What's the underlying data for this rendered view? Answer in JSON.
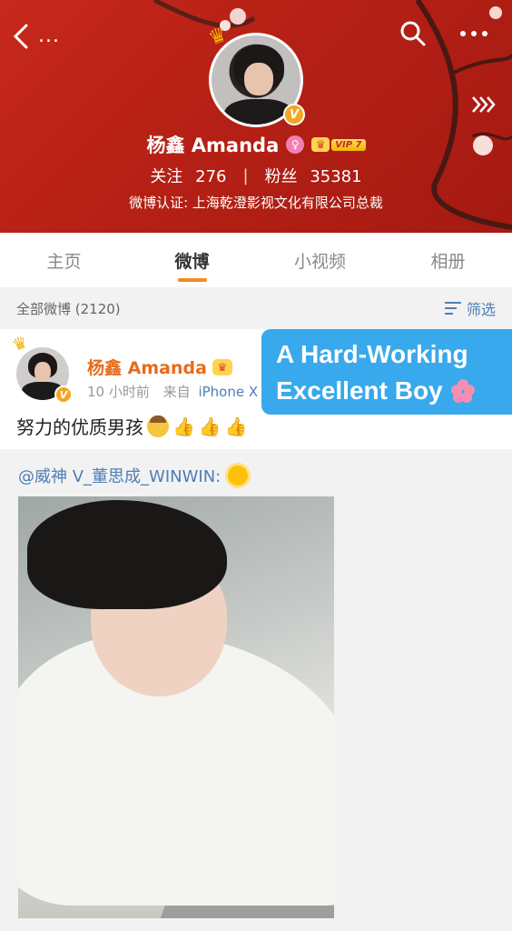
{
  "header": {
    "back_dots": "...",
    "profile_name": "杨鑫 Amanda",
    "female_badge_icon": "female-symbol-icon",
    "vip_label": "VIP 7",
    "follow_label": "关注",
    "follow_count": "276",
    "fans_label": "粉丝",
    "fans_count": "35381",
    "separator": "|",
    "certification": "微博认证: 上海乾澄影视文化有限公司总裁",
    "banner_color": "#c8281c"
  },
  "tabs": [
    {
      "label": "主页",
      "active": false
    },
    {
      "label": "微博",
      "active": true
    },
    {
      "label": "小视频",
      "active": false
    },
    {
      "label": "相册",
      "active": false
    }
  ],
  "filter": {
    "count_label": "全部微博 (2120)",
    "filter_label": "筛选"
  },
  "post": {
    "author": "杨鑫 Amanda",
    "time": "10 小时前",
    "from_label": "来自",
    "device": "iPhone X",
    "text": "努力的优质男孩",
    "accent_color": "#e86b1c",
    "link_color": "#4d7fb5"
  },
  "caption": {
    "line1": "A Hard-Working",
    "line2": "Excellent Boy",
    "background": "#38a9ec"
  },
  "repost": {
    "mention": "@威神 V_董思成_WINWIN:"
  }
}
